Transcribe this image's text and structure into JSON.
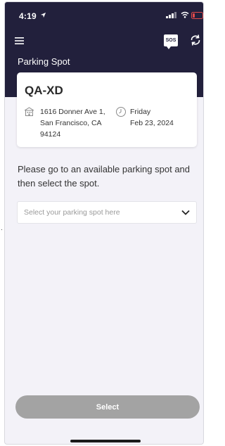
{
  "status_bar": {
    "time": "4:19"
  },
  "header": {
    "title": "Parking Spot",
    "sos_label": "SOS",
    "background": "#22203c"
  },
  "card": {
    "title": "QA-XD",
    "address": "1616 Donner Ave 1, San Francisco, CA 94124",
    "day": "Friday",
    "date": "Feb 23, 2024"
  },
  "main": {
    "instruction": "Please go to an available parking spot and then select the spot.",
    "dropdown_placeholder": "Select your parking spot here",
    "select_button_label": "Select",
    "select_button_color": "#a3a3a3"
  },
  "icons": {
    "menu": "menu-icon",
    "sos": "sos-icon",
    "refresh": "refresh-icon",
    "building": "building-icon",
    "clock": "clock-icon",
    "chevron": "chevron-down-icon"
  }
}
